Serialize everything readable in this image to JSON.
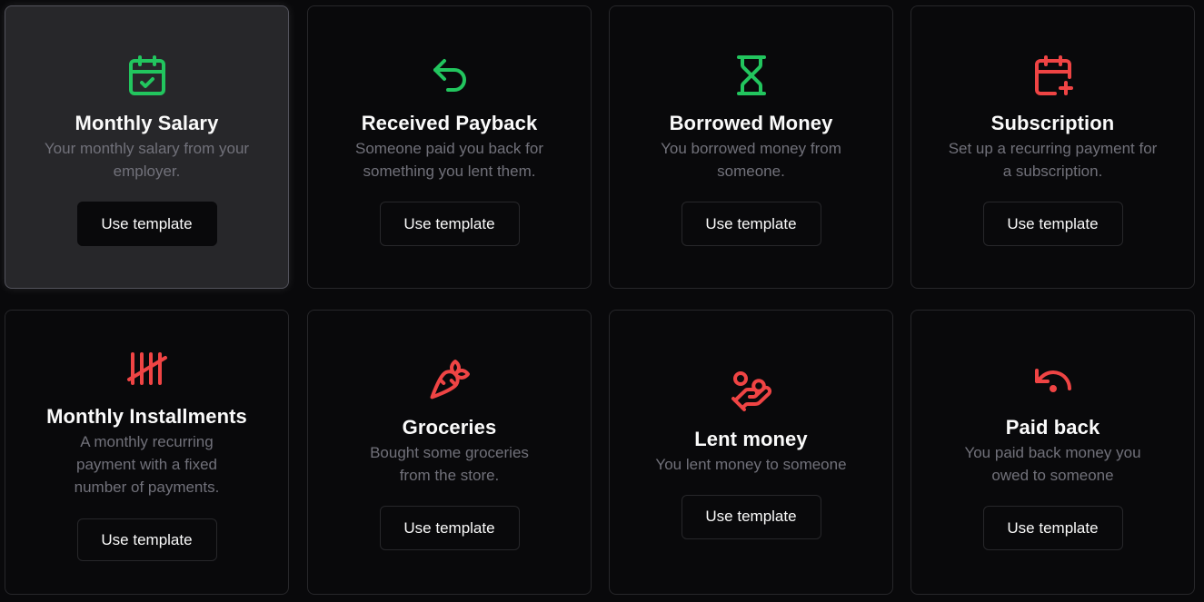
{
  "colors": {
    "income": "#22c55e",
    "expense": "#ef4444"
  },
  "templates": [
    {
      "icon": "calendar-check-icon",
      "title": "Monthly Salary",
      "description": "Your monthly salary from your employer.",
      "button": "Use template"
    },
    {
      "icon": "undo-arrow-icon",
      "title": "Received Payback",
      "description": "Someone paid you back for something you lent them.",
      "button": "Use template"
    },
    {
      "icon": "hourglass-icon",
      "title": "Borrowed Money",
      "description": "You borrowed money from someone.",
      "button": "Use template"
    },
    {
      "icon": "calendar-plus-icon",
      "title": "Subscription",
      "description": "Set up a recurring payment for a subscription.",
      "button": "Use template"
    },
    {
      "icon": "tally-marks-icon",
      "title": "Monthly Installments",
      "description": "A monthly recurring payment with a fixed number of payments.",
      "button": "Use template"
    },
    {
      "icon": "carrot-icon",
      "title": "Groceries",
      "description": "Bought some groceries from the store.",
      "button": "Use template"
    },
    {
      "icon": "hand-coins-icon",
      "title": "Lent money",
      "description": "You lent money to someone",
      "button": "Use template"
    },
    {
      "icon": "undo-dot-icon",
      "title": "Paid back",
      "description": "You paid back money you owed to someone",
      "button": "Use template"
    }
  ]
}
